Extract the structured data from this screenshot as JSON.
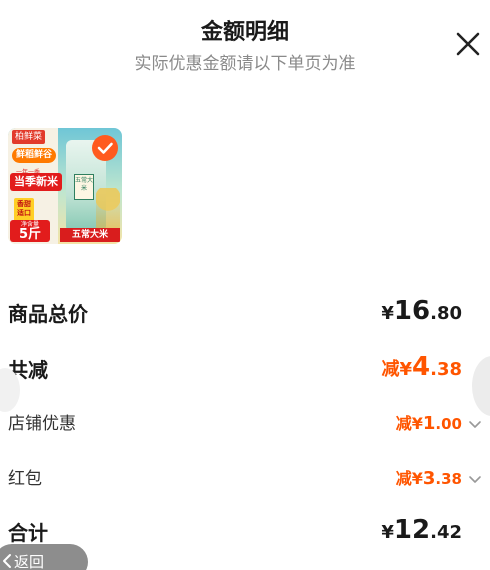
{
  "header": {
    "title": "金额明细",
    "subtitle": "实际优惠金额请以下单页为准"
  },
  "product": {
    "brand_tag": "柏鲜菜",
    "fresh_tag": "鲜稻鲜谷",
    "small_line": "一年一季",
    "season_tag": "当季新米",
    "fragrance_tag": "香甜适口",
    "net_label": "净含量",
    "weight": "5斤",
    "bag_label": "五常大米",
    "variety_tag": "五常大米",
    "selected": true
  },
  "rows": [
    {
      "label": "商品总价",
      "prefix": "¥",
      "int": "16",
      "dec": ".80",
      "color": "#1a1a1a"
    },
    {
      "label": "共减",
      "prefix": "减¥",
      "int": "4",
      "dec": ".38",
      "color": "#ff5500"
    },
    {
      "label": "店铺优惠",
      "prefix": "减¥",
      "int": "1",
      "dec": ".00",
      "color": "#ff5500"
    },
    {
      "label": "红包",
      "prefix": "减¥",
      "int": "3",
      "dec": ".38",
      "color": "#ff5500"
    },
    {
      "label": "合计",
      "prefix": "¥",
      "int": "12",
      "dec": ".42",
      "color": "#1a1a1a"
    }
  ],
  "back_button": {
    "label": "返回"
  },
  "icons": {
    "close": "close-icon",
    "check": "check-icon",
    "chevron": "chevron-down-icon",
    "back": "chevron-left-icon"
  },
  "colors": {
    "accent": "#ff5500",
    "text": "#1a1a1a",
    "muted": "#8a8a8a"
  }
}
